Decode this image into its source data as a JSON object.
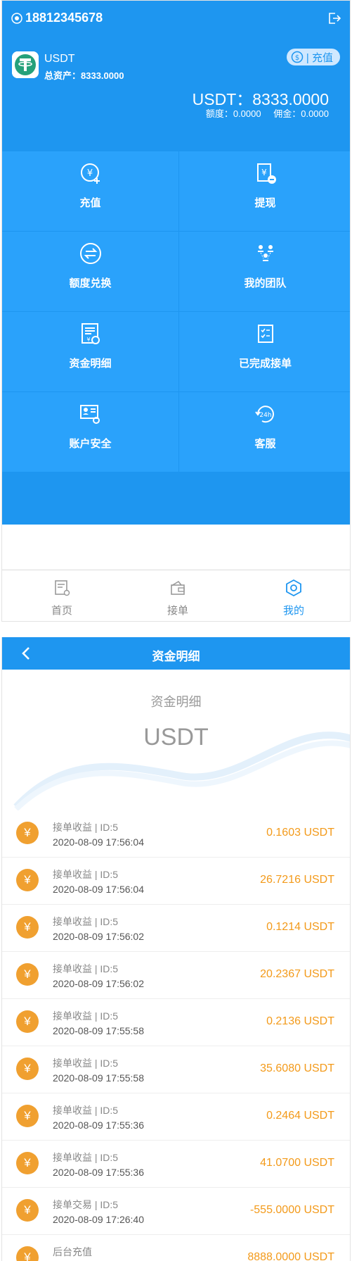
{
  "account": {
    "phone": "18812345678",
    "coin_name": "USDT",
    "total_assets_label": "总资产：8333.0000",
    "recharge_label": "| 充值",
    "balance_main": "USDT：8333.0000",
    "quota": "额度：0.0000",
    "commission": "佣金：0.0000"
  },
  "menu": [
    {
      "label": "充值",
      "icon": "recharge-icon"
    },
    {
      "label": "提现",
      "icon": "withdraw-icon"
    },
    {
      "label": "额度兑换",
      "icon": "exchange-icon"
    },
    {
      "label": "我的团队",
      "icon": "team-icon"
    },
    {
      "label": "资金明细",
      "icon": "statement-icon"
    },
    {
      "label": "已完成接单",
      "icon": "completed-orders-icon"
    },
    {
      "label": "账户安全",
      "icon": "account-security-icon"
    },
    {
      "label": "客服",
      "icon": "customer-service-icon"
    }
  ],
  "tabs": [
    {
      "label": "首页",
      "icon": "home-icon",
      "active": false
    },
    {
      "label": "接单",
      "icon": "wallet-icon",
      "active": false
    },
    {
      "label": "我的",
      "icon": "profile-icon",
      "active": true
    }
  ],
  "details_page": {
    "nav_title": "资金明细",
    "banner_subtitle": "资金明细",
    "banner_big": "USDT",
    "records": [
      {
        "title": "接单收益 | ID:5",
        "time": "2020-08-09 17:56:04",
        "amount": "0.1603 USDT"
      },
      {
        "title": "接单收益 | ID:5",
        "time": "2020-08-09 17:56:04",
        "amount": "26.7216 USDT"
      },
      {
        "title": "接单收益 | ID:5",
        "time": "2020-08-09 17:56:02",
        "amount": "0.1214 USDT"
      },
      {
        "title": "接单收益 | ID:5",
        "time": "2020-08-09 17:56:02",
        "amount": "20.2367 USDT"
      },
      {
        "title": "接单收益 | ID:5",
        "time": "2020-08-09 17:55:58",
        "amount": "0.2136 USDT"
      },
      {
        "title": "接单收益 | ID:5",
        "time": "2020-08-09 17:55:58",
        "amount": "35.6080 USDT"
      },
      {
        "title": "接单收益 | ID:5",
        "time": "2020-08-09 17:55:36",
        "amount": "0.2464 USDT"
      },
      {
        "title": "接单收益 | ID:5",
        "time": "2020-08-09 17:55:36",
        "amount": "41.0700 USDT"
      },
      {
        "title": "接单交易 | ID:5",
        "time": "2020-08-09 17:26:40",
        "amount": "-555.0000 USDT"
      },
      {
        "title": "后台充值",
        "time": "",
        "amount": "8888.0000 USDT"
      }
    ],
    "record_icon_glyph": "¥"
  },
  "colors": {
    "primary": "#1e96f0",
    "tile": "#2aa2fb",
    "amount": "#f39a1a",
    "coin_badge": "#f0a030"
  }
}
